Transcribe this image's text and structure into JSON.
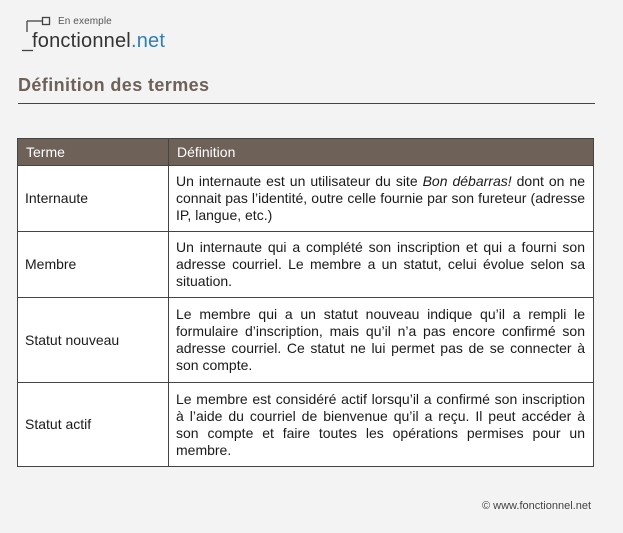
{
  "logo": {
    "tagline": "En exemple",
    "word_main": "fonctionnel",
    "word_suffix": ".net",
    "icon": "logo-square-icon"
  },
  "page_title": "Définition des termes",
  "table": {
    "headers": [
      "Terme",
      "Définition"
    ],
    "rows": [
      {
        "term": "Internaute",
        "definition_before": "Un internaute est un utilisateur du site ",
        "definition_emph": "Bon débarras!",
        "definition_after": " dont on ne connait pas l’identité, outre celle fournie par son fureteur (adresse IP, langue, etc.)"
      },
      {
        "term": "Membre",
        "definition": "Un internaute qui a complété son inscription et qui a fourni son adresse courriel. Le membre a un statut, celui évolue selon sa situation."
      },
      {
        "term": "Statut nouveau",
        "definition": "Le membre qui a un statut nouveau indique qu’il a rempli le formulaire d’inscription, mais qu’il n’a pas encore confirmé son adresse courriel. Ce statut ne lui permet pas de se connecter à son compte."
      },
      {
        "term": "Statut actif",
        "definition": "Le membre est considéré actif lorsqu’il a confirmé son inscription à l’aide du courriel de bienvenue qu’il a reçu. Il peut accéder à son compte et faire toutes les opérations permises pour un membre."
      }
    ]
  },
  "footer": "© www.fonctionnel.net",
  "colors": {
    "header_bg": "#6e6158",
    "title": "#6e6158",
    "accent_net": "#2e7fb8",
    "page_bg": "#f3f3f3"
  }
}
